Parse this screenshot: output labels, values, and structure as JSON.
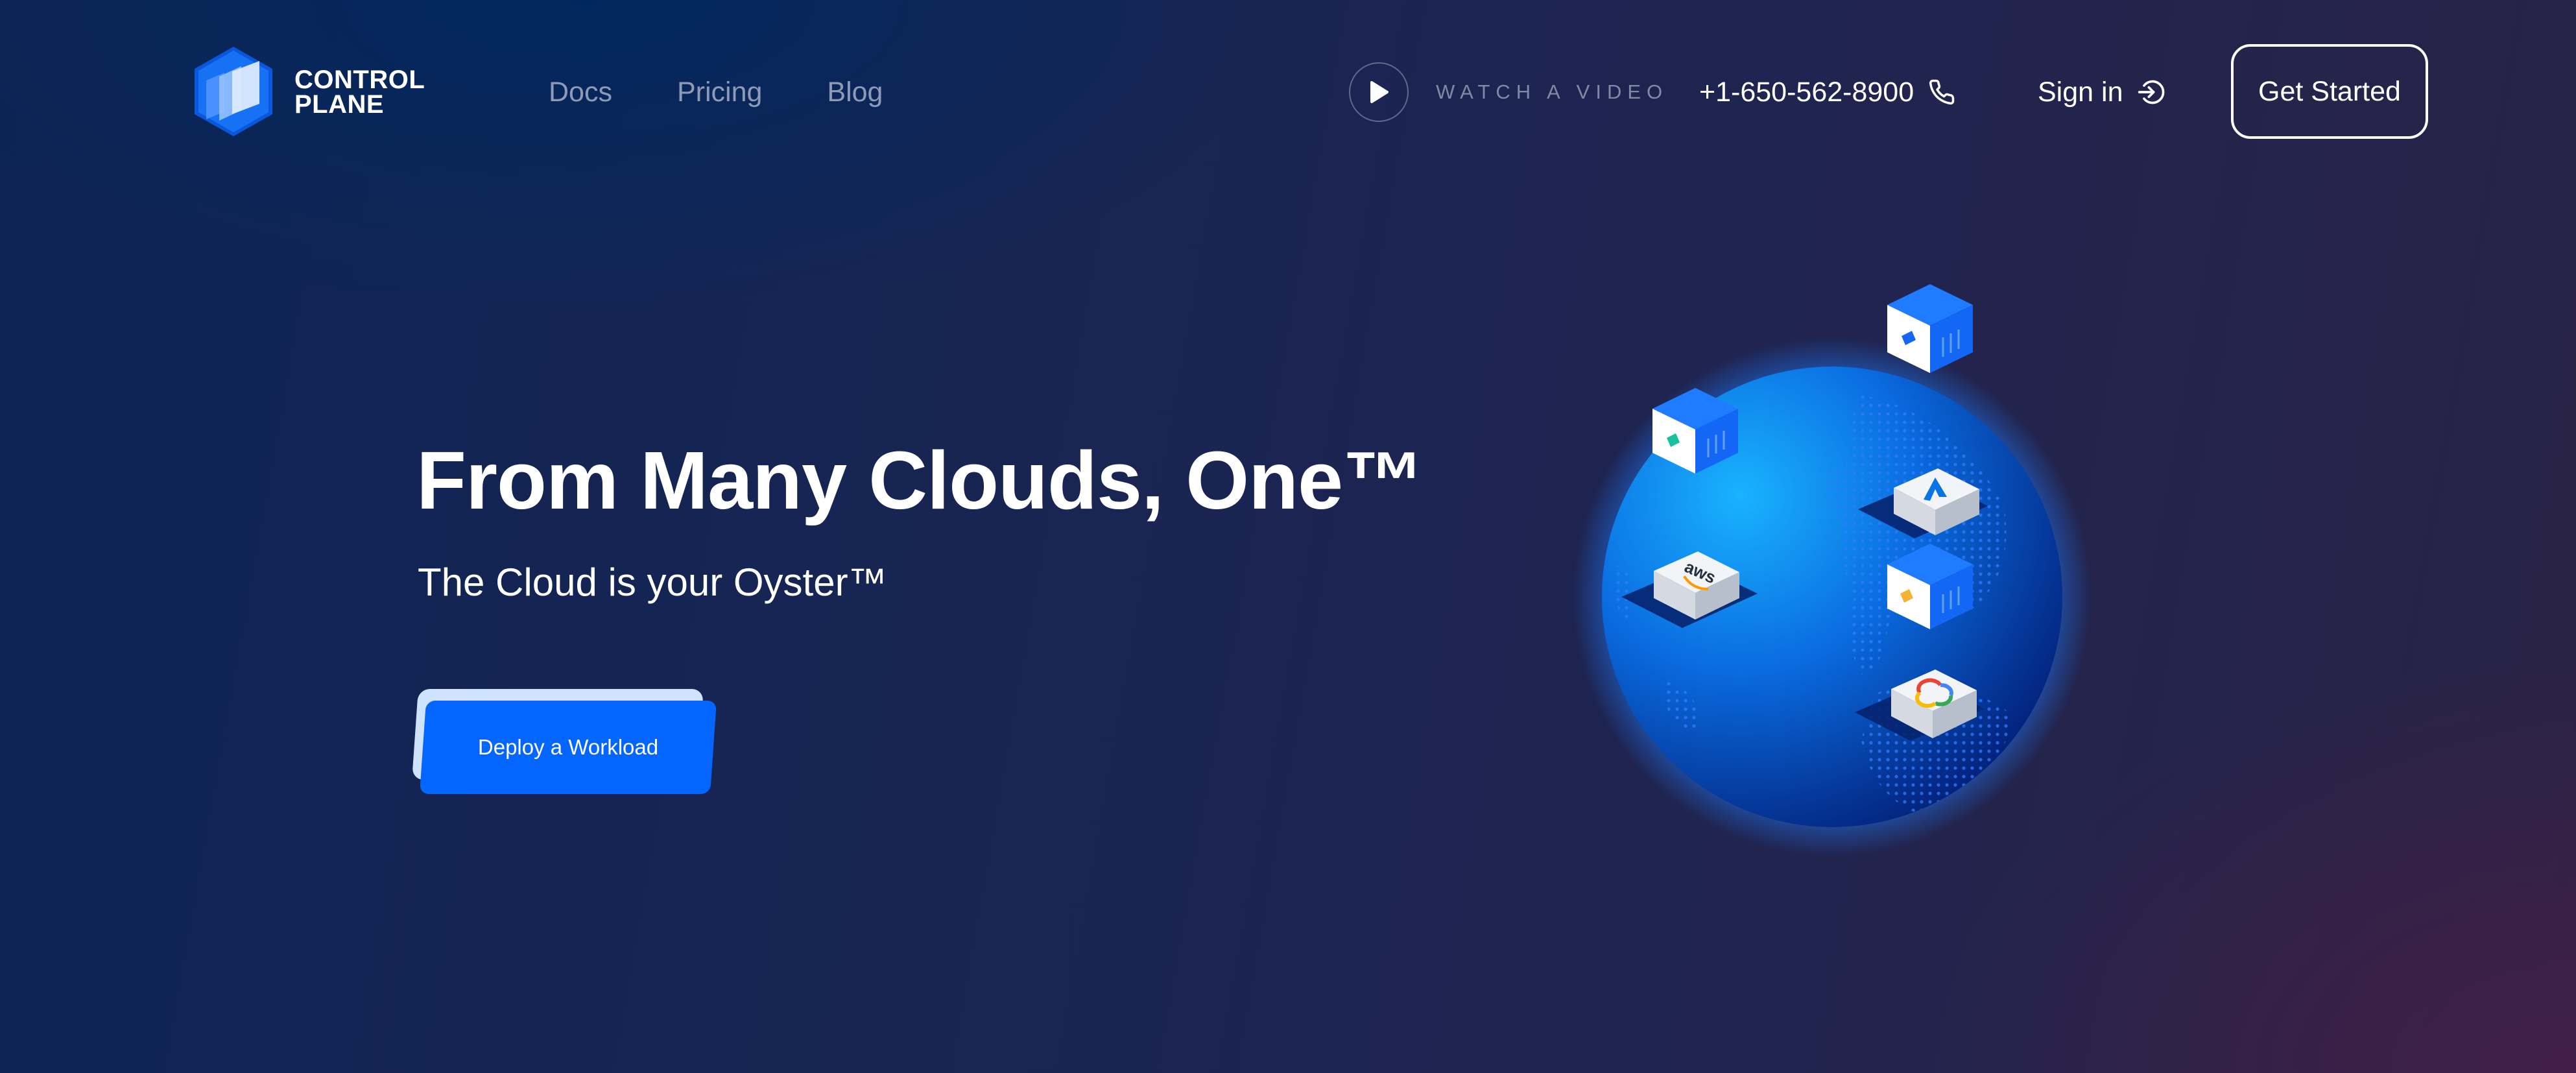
{
  "header": {
    "logo": {
      "line1": "CONTROL",
      "line2": "PLANE"
    },
    "nav": [
      {
        "label": "Docs"
      },
      {
        "label": "Pricing"
      },
      {
        "label": "Blog"
      }
    ],
    "watch_video_label": "WATCH A VIDEO",
    "phone": "+1-650-562-8900",
    "sign_in_label": "Sign in",
    "get_started_label": "Get Started"
  },
  "hero": {
    "title": "From Many Clouds, One™",
    "subtitle": "The Cloud is your Oyster™",
    "cta_label": "Deploy a Workload"
  },
  "illustration": {
    "provider_labels": [
      "aws"
    ]
  },
  "colors": {
    "accent": "#0565ff",
    "background": "#172553",
    "nav_text": "#8f9bb6",
    "globe": "#0a6be0"
  }
}
